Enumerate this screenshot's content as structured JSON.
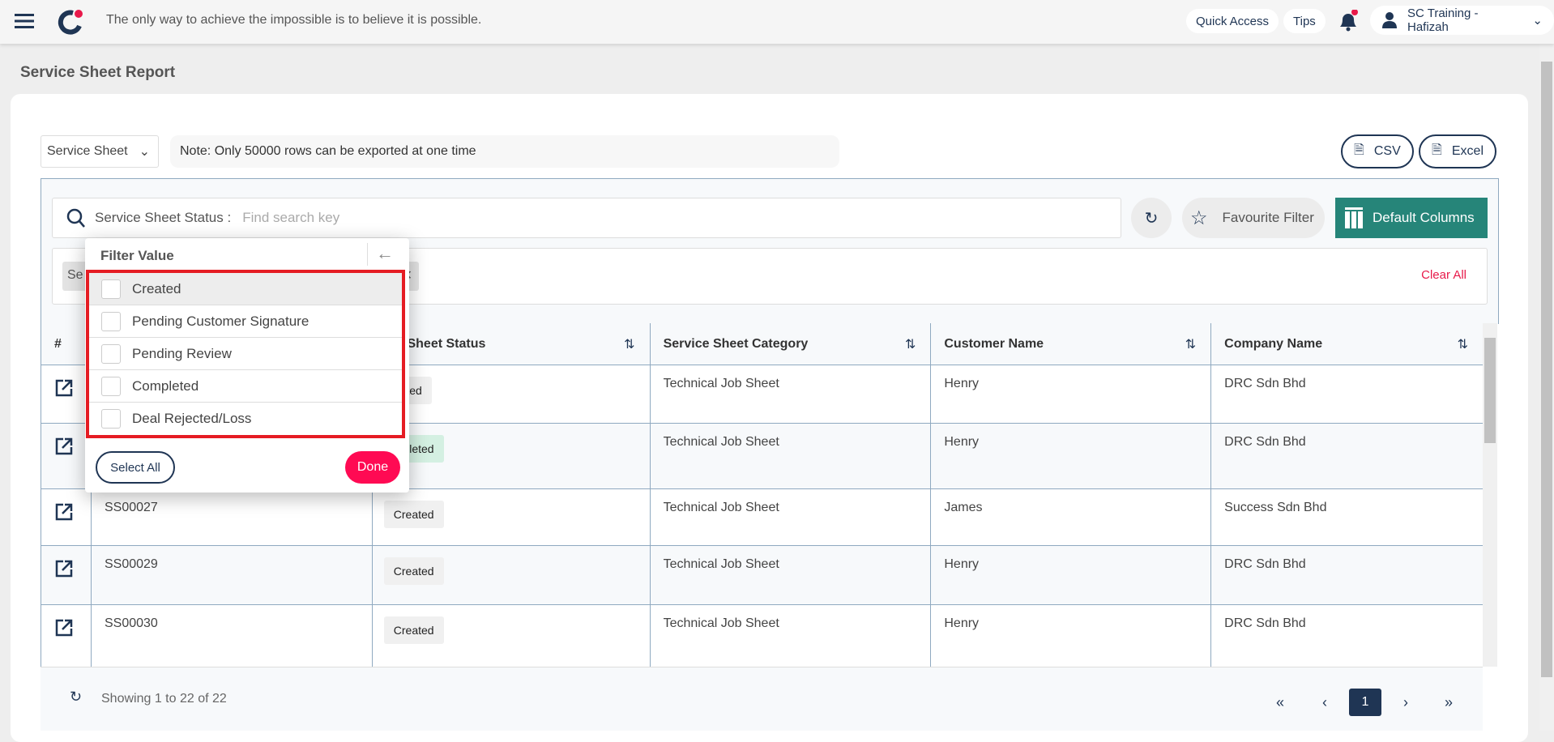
{
  "header": {
    "quote": "The only way to achieve the impossible is to believe it is possible.",
    "quick_access": "Quick Access",
    "tips": "Tips",
    "user": "SC Training - Hafizah",
    "brand_color": "#1f3554",
    "accent_color": "#e8194a"
  },
  "page": {
    "title": "Service Sheet Report"
  },
  "toolbar": {
    "report_type": "Service Sheet",
    "note": "Note: Only 50000 rows can be exported at one time",
    "csv": "CSV",
    "excel": "Excel"
  },
  "filter": {
    "search_label": "Service Sheet Status :",
    "search_placeholder": "Find search key",
    "favourite": "Favourite Filter",
    "default_columns": "Default Columns",
    "chip_prefix": "Se",
    "clear_all": "Clear All"
  },
  "popup": {
    "title": "Filter Value",
    "options": [
      "Created",
      "Pending Customer Signature",
      "Pending Review",
      "Completed",
      "Deal Rejected/Loss"
    ],
    "select_all": "Select All",
    "done": "Done"
  },
  "table": {
    "headers": [
      "#",
      "",
      "ice Sheet Status",
      "Service Sheet Category",
      "Customer Name",
      "Company Name"
    ],
    "rows": [
      {
        "id": "",
        "status": "eated",
        "category": "Technical Job Sheet",
        "customer": "Henry",
        "company": "DRC Sdn Bhd"
      },
      {
        "id": "",
        "status": "mpleted",
        "category": "Technical Job Sheet",
        "customer": "Henry",
        "company": "DRC Sdn Bhd"
      },
      {
        "id": "SS00027",
        "status": "Created",
        "category": "Technical Job Sheet",
        "customer": "James",
        "company": "Success Sdn Bhd"
      },
      {
        "id": "SS00029",
        "status": "Created",
        "category": "Technical Job Sheet",
        "customer": "Henry",
        "company": "DRC Sdn Bhd"
      },
      {
        "id": "SS00030",
        "status": "Created",
        "category": "Technical Job Sheet",
        "customer": "Henry",
        "company": "DRC Sdn Bhd"
      }
    ]
  },
  "footer": {
    "showing": "Showing 1 to 22 of 22",
    "page": "1"
  }
}
